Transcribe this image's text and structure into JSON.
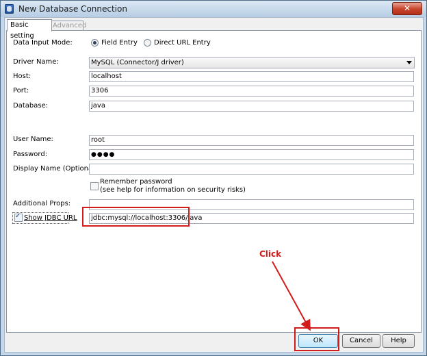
{
  "window": {
    "title": "New Database Connection",
    "close_glyph": "✕"
  },
  "tabs": [
    {
      "label": "Basic setting",
      "active": true
    },
    {
      "label": "Advanced",
      "active": false
    }
  ],
  "form": {
    "data_input_mode": {
      "label": "Data Input Mode:",
      "options": [
        "Field Entry",
        "Direct URL Entry"
      ],
      "selected": "Field Entry"
    },
    "driver_name": {
      "label": "Driver Name:",
      "value": "MySQL (Connector/J driver)"
    },
    "host": {
      "label": "Host:",
      "value": "localhost"
    },
    "port": {
      "label": "Port:",
      "value": "3306"
    },
    "database": {
      "label": "Database:",
      "value": "java"
    },
    "user_name": {
      "label": "User Name:",
      "value": "root"
    },
    "password": {
      "label": "Password:",
      "value": "●●●●"
    },
    "display_name": {
      "label": "Display Name (Optional):",
      "value": ""
    },
    "remember_password": {
      "label_line1": "Remember password",
      "label_line2": "(see help for information on security risks)",
      "checked": false
    },
    "additional_props": {
      "label": "Additional Props:",
      "value": ""
    },
    "show_jdbc_url": {
      "label": "Show JDBC URL",
      "checked": true
    },
    "jdbc_url": {
      "value": "jdbc:mysql://localhost:3306/java"
    }
  },
  "buttons": {
    "ok": "OK",
    "cancel": "Cancel",
    "help": "Help"
  },
  "annotation": {
    "text": "Click",
    "color": "#d21b1b"
  },
  "colors": {
    "annotation_red": "#d21b1b",
    "title_gradient_top": "#dbe8f5",
    "default_button": "#bee6fd"
  }
}
